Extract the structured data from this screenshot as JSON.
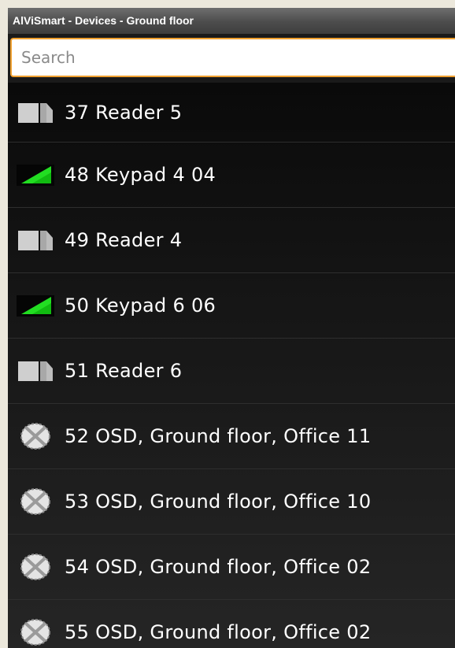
{
  "window": {
    "title": "AlViSmart - Devices - Ground floor"
  },
  "search": {
    "placeholder": "Search",
    "value": ""
  },
  "devices": [
    {
      "label": "37 Reader 5",
      "icon": "reader-icon"
    },
    {
      "label": "48 Keypad 4 04",
      "icon": "keypad-icon"
    },
    {
      "label": "49 Reader 4",
      "icon": "reader-icon"
    },
    {
      "label": "50 Keypad 6 06",
      "icon": "keypad-icon"
    },
    {
      "label": "51 Reader 6",
      "icon": "reader-icon"
    },
    {
      "label": "52 OSD, Ground floor, Office 11",
      "icon": "osd-icon"
    },
    {
      "label": "53 OSD, Ground floor, Office 10",
      "icon": "osd-icon"
    },
    {
      "label": "54 OSD, Ground floor, Office 02",
      "icon": "osd-icon"
    },
    {
      "label": "55 OSD, Ground floor, Office 02",
      "icon": "osd-icon"
    }
  ],
  "colors": {
    "accent_orange": "#f0a030",
    "keypad_green": "#22dd22",
    "reader_grey": "#cfcfcf"
  }
}
